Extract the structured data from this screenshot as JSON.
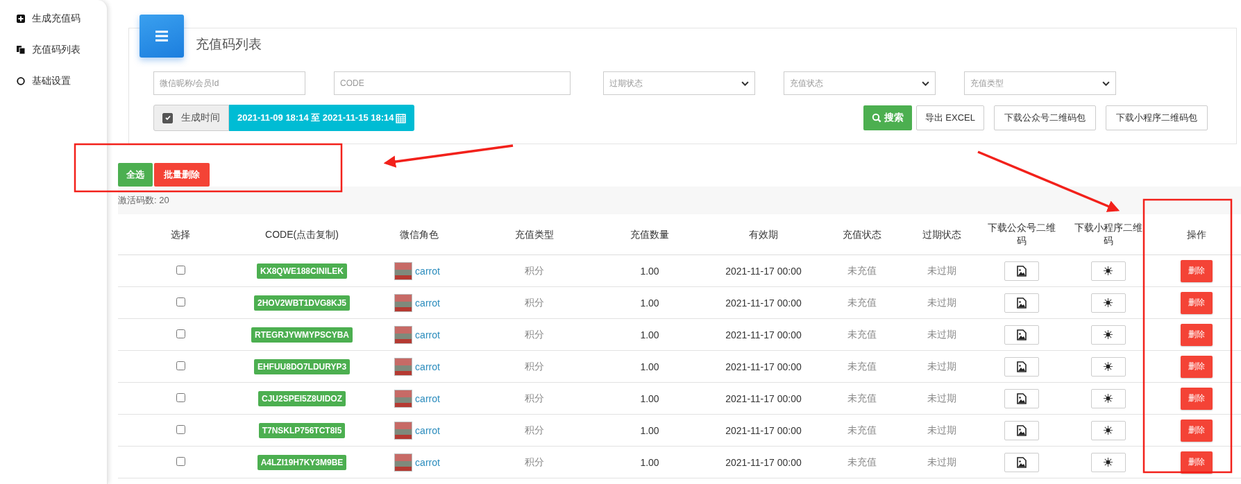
{
  "sidebar": {
    "items": [
      {
        "label": "生成充值码"
      },
      {
        "label": "充值码列表"
      },
      {
        "label": "基础设置"
      }
    ]
  },
  "card": {
    "title": "充值码列表"
  },
  "filters": {
    "nickname": {
      "placeholder": "微信昵称/会员Id"
    },
    "code": {
      "placeholder": "CODE"
    },
    "selects": [
      "过期状态",
      "充值状态",
      "充值类型"
    ],
    "time_filter": {
      "label": "生成时间",
      "checked": true,
      "range": "2021-11-09 18:14 至 2021-11-15 18:14"
    }
  },
  "actions": {
    "search": "搜索",
    "export": "导出 EXCEL",
    "download_official": "下载公众号二维码包",
    "download_mini": "下载小程序二维码包"
  },
  "bulk": {
    "select_all": "全选",
    "delete_all": "批量删除"
  },
  "count": "激活码数: 20",
  "table": {
    "columns": [
      "选择",
      "CODE(点击复制)",
      "微信角色",
      "充值类型",
      "充值数量",
      "有效期",
      "充值状态",
      "过期状态",
      "下载公众号二维码",
      "下载小程序二维码",
      "操作"
    ],
    "rows": [
      {
        "checked": false,
        "code": "KX8QWE188CINILEK",
        "role": "carrot",
        "type": "积分",
        "amount": "1.00",
        "expiry": "2021-11-17 00:00",
        "charge_status": "未充值",
        "expire_status": "未过期",
        "action": "删除"
      },
      {
        "checked": false,
        "code": "2HOV2WBT1DVG8KJ5",
        "role": "carrot",
        "type": "积分",
        "amount": "1.00",
        "expiry": "2021-11-17 00:00",
        "charge_status": "未充值",
        "expire_status": "未过期",
        "action": "删除"
      },
      {
        "checked": false,
        "code": "RTEGRJYWMYPSCYBA",
        "role": "carrot",
        "type": "积分",
        "amount": "1.00",
        "expiry": "2021-11-17 00:00",
        "charge_status": "未充值",
        "expire_status": "未过期",
        "action": "删除"
      },
      {
        "checked": false,
        "code": "EHFUU8DO7LDURYP3",
        "role": "carrot",
        "type": "积分",
        "amount": "1.00",
        "expiry": "2021-11-17 00:00",
        "charge_status": "未充值",
        "expire_status": "未过期",
        "action": "删除"
      },
      {
        "checked": false,
        "code": "CJU2SPEI5Z8UIDOZ",
        "role": "carrot",
        "type": "积分",
        "amount": "1.00",
        "expiry": "2021-11-17 00:00",
        "charge_status": "未充值",
        "expire_status": "未过期",
        "action": "删除"
      },
      {
        "checked": false,
        "code": "T7NSKLP756TCT8I5",
        "role": "carrot",
        "type": "积分",
        "amount": "1.00",
        "expiry": "2021-11-17 00:00",
        "charge_status": "未充值",
        "expire_status": "未过期",
        "action": "删除"
      },
      {
        "checked": false,
        "code": "A4LZI19H7KY3M9BE",
        "role": "carrot",
        "type": "积分",
        "amount": "1.00",
        "expiry": "2021-11-17 00:00",
        "charge_status": "未充值",
        "expire_status": "未过期",
        "action": "删除"
      }
    ]
  }
}
